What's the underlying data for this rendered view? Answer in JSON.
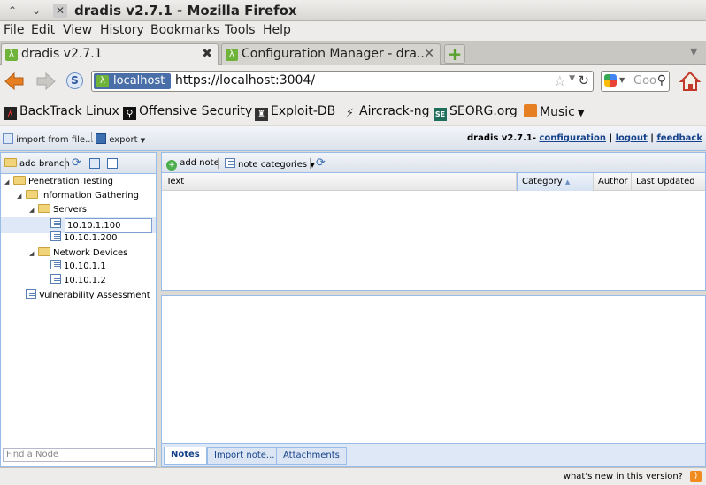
{
  "window": {
    "title": "dradis v2.7.1 - Mozilla Firefox"
  },
  "menu": [
    "File",
    "Edit",
    "View",
    "History",
    "Bookmarks",
    "Tools",
    "Help"
  ],
  "tabs": [
    {
      "label": "dradis v2.7.1",
      "active": true
    },
    {
      "label": "Configuration Manager - dra...",
      "active": false
    }
  ],
  "nav": {
    "identity": "localhost",
    "url": "https://localhost:3004/",
    "search_placeholder": "Goo"
  },
  "bookmarks": [
    "BackTrack Linux",
    "Offensive Security",
    "Exploit-DB",
    "Aircrack-ng",
    "SEORG.org",
    "Music"
  ],
  "app": {
    "import_label": "import from file...",
    "export_label": "export",
    "brand": "dradis v2.7.1-",
    "configuration": "configuration",
    "logout": "logout",
    "feedback": "feedback",
    "sep": "|"
  },
  "tree": {
    "add_branch": "add branch",
    "nodes": {
      "root": "Penetration Testing",
      "info": "Information Gathering",
      "servers": "Servers",
      "server1": "10.10.1.100",
      "server2": "10.10.1.200",
      "netdev": "Network Devices",
      "dev1": "10.10.1.1",
      "dev2": "10.10.1.2",
      "vuln": "Vulnerability Assessment"
    },
    "find_placeholder": "Find a Node"
  },
  "notes": {
    "add_note": "add note",
    "note_categories": "note categories",
    "columns": [
      "Text",
      "Category",
      "Author",
      "Last Updated"
    ]
  },
  "bottom_tabs": [
    "Notes",
    "Import note...",
    "Attachments"
  ],
  "status": {
    "whats_new": "what's new in this version?"
  }
}
